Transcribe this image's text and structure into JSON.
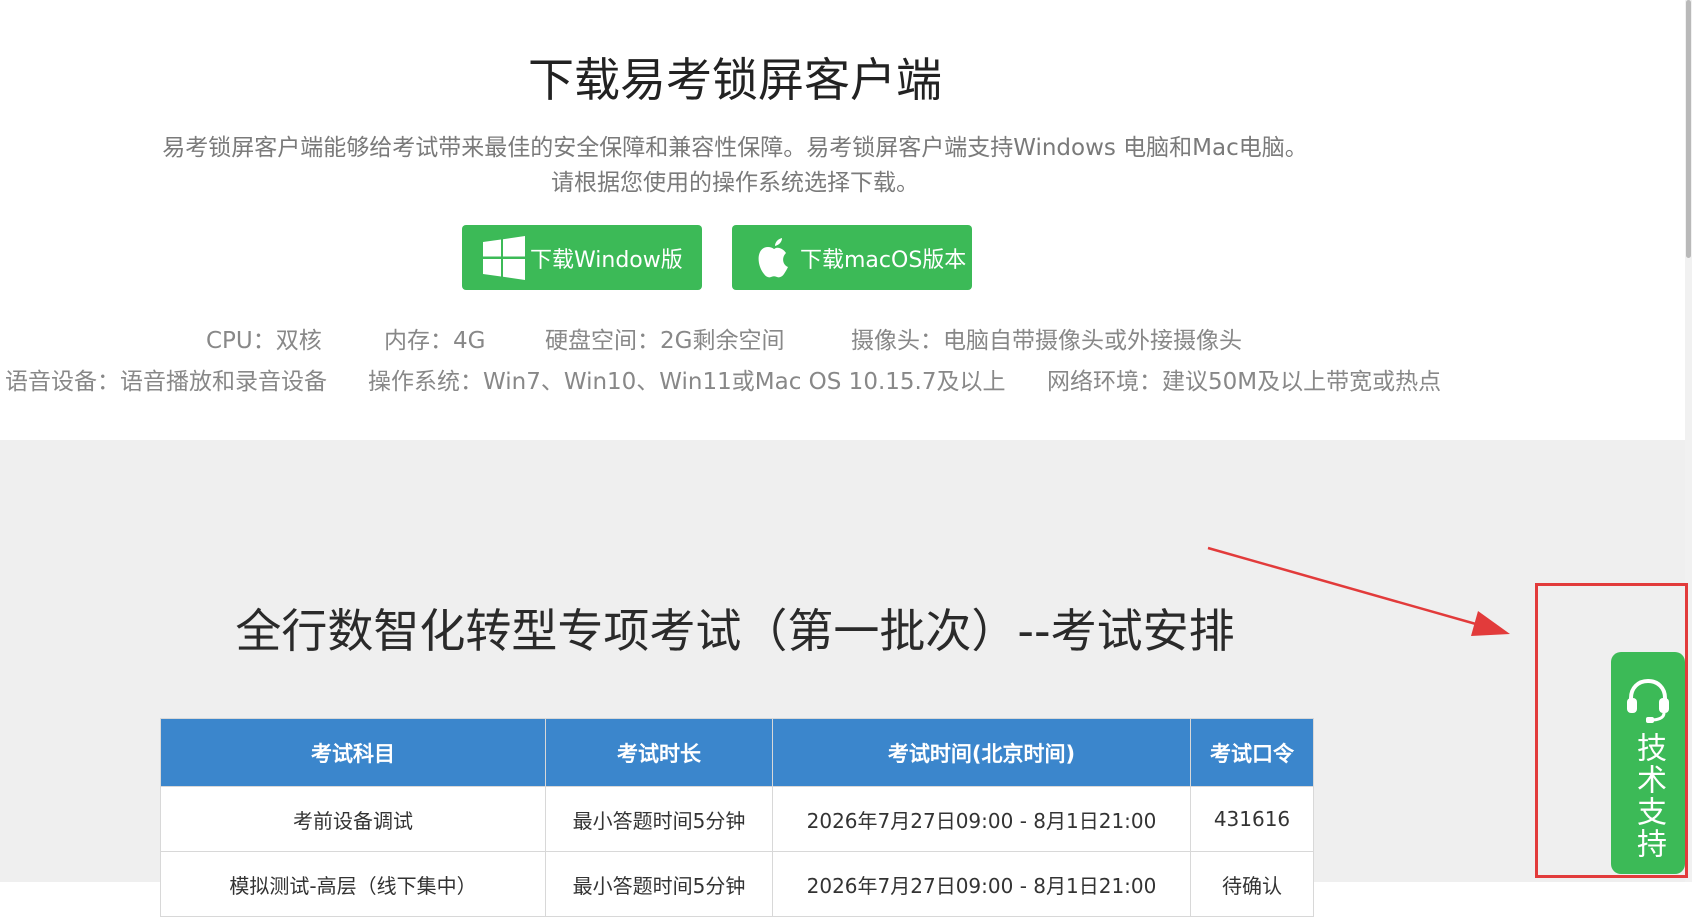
{
  "download": {
    "title": "下载易考锁屏客户端",
    "desc_line1": "易考锁屏客户端能够给考试带来最佳的安全保障和兼容性保障。易考锁屏客户端支持Windows 电脑和Mac电脑。",
    "desc_line2": "请根据您使用的操作系统选择下载。",
    "windows_btn": "下载Window版",
    "mac_btn": "下载macOS版本"
  },
  "requirements": {
    "cpu": "CPU：双核",
    "memory": "内存：4G",
    "disk": "硬盘空间：2G剩余空间",
    "camera": "摄像头：电脑自带摄像头或外接摄像头",
    "audio": "语音设备：语音播放和录音设备",
    "os": "操作系统：Win7、Win10、Win11或Mac OS 10.15.7及以上",
    "network": "网络环境：建议50M及以上带宽或热点"
  },
  "exam": {
    "title": "全行数智化转型专项考试（第一批次）--考试安排",
    "headers": [
      "考试科目",
      "考试时长",
      "考试时间(北京时间)",
      "考试口令"
    ],
    "rows": [
      [
        "考前设备调试",
        "最小答题时间5分钟",
        "2026年7月27日09:00 - 8月1日21:00",
        "431616"
      ],
      [
        "模拟测试-高层（线下集中）",
        "最小答题时间5分钟",
        "2026年7月27日09:00 - 8月1日21:00",
        "待确认"
      ]
    ]
  },
  "support": {
    "label": "技术支持"
  },
  "colors": {
    "brand_green": "#3cba57",
    "header_blue": "#3b86cc",
    "highlight_red": "#e23b3b",
    "gray_bg": "#efefef"
  },
  "icons": [
    "windows-logo-icon",
    "apple-logo-icon",
    "headset-icon"
  ]
}
